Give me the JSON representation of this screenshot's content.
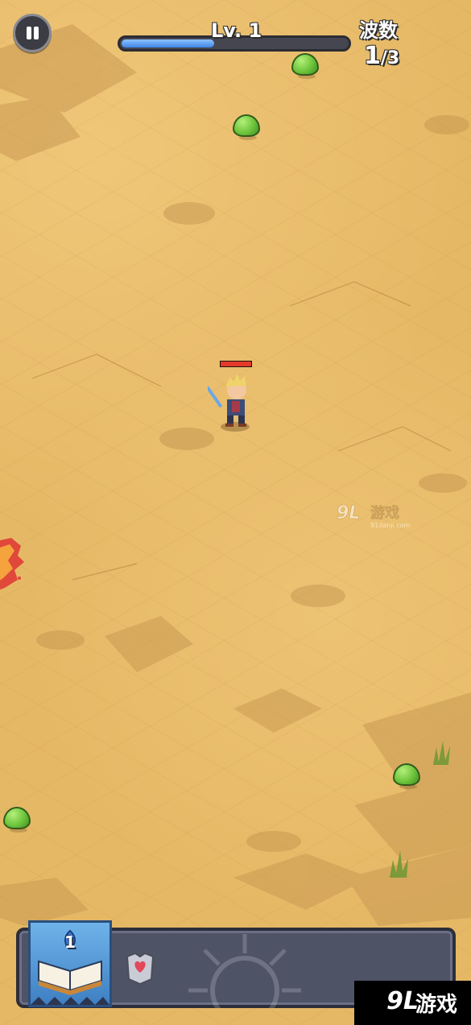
{
  "hud": {
    "level_label": "Lv. 1",
    "xp_progress": 0.41,
    "wave_title": "波数",
    "wave_current": "1",
    "wave_total_text": "/3"
  },
  "watermark": {
    "brand": "91游戏",
    "url": "91danji.com"
  },
  "skills": {
    "book_level": "1"
  },
  "branding": {
    "logo_number": "9L",
    "logo_text": "游戏"
  },
  "colors": {
    "sand": "#e5b865",
    "xp_fill": "#3f86e8",
    "slime": "#6cc43a",
    "panel": "#4f5366"
  },
  "icons": [
    "pause-icon",
    "spellbook-icon",
    "armor-heart-icon",
    "slime-icon",
    "hero-icon",
    "fire-enemy-icon"
  ]
}
